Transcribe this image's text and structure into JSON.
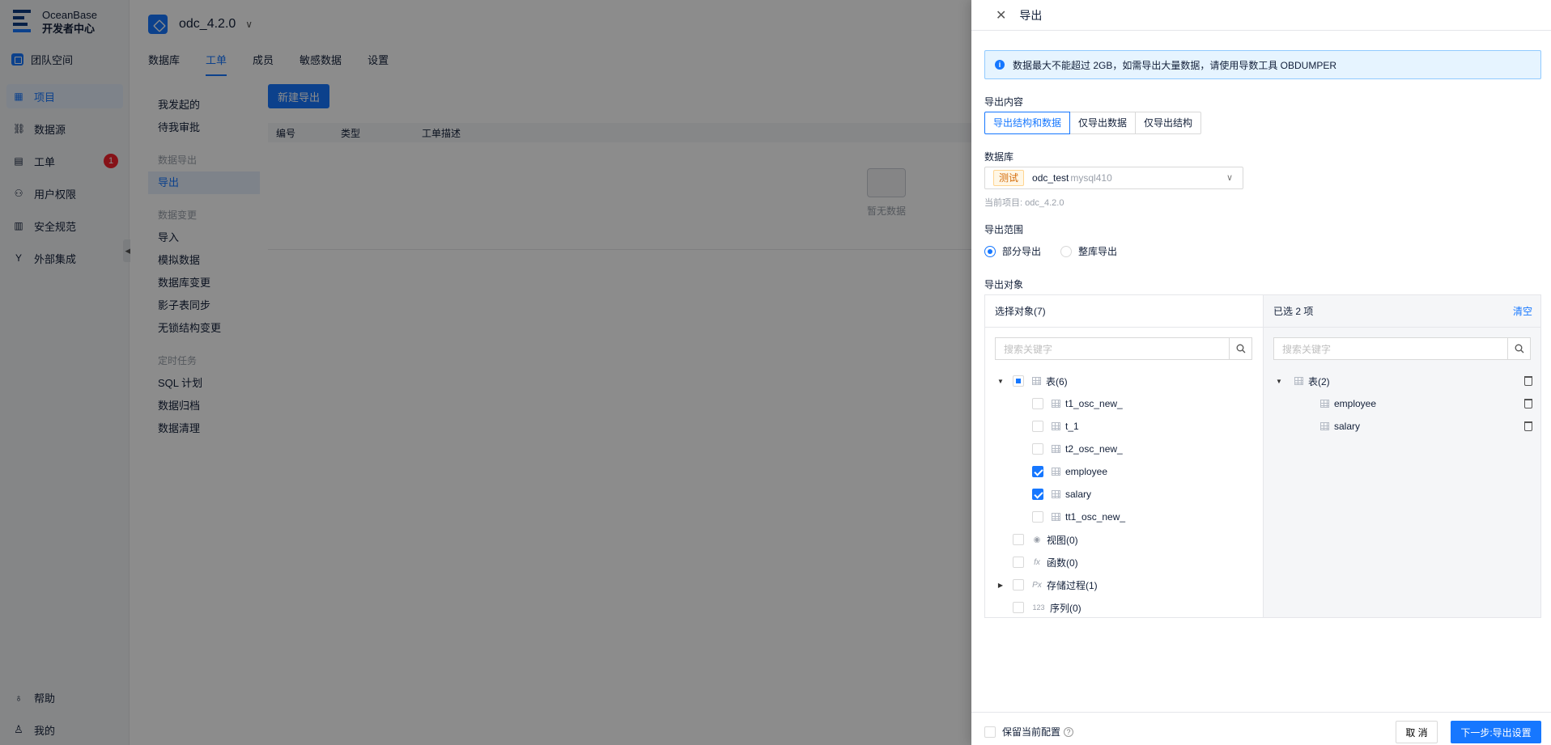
{
  "app": {
    "logo_line1": "OceanBase",
    "logo_line2": "开发者中心",
    "team_space": "团队空间",
    "nav": [
      {
        "label": "项目",
        "icon": "grid-icon",
        "active": true
      },
      {
        "label": "数据源",
        "icon": "link-icon"
      },
      {
        "label": "工单",
        "icon": "briefcase-icon",
        "badge": "1"
      },
      {
        "label": "用户权限",
        "icon": "user-permission-icon"
      },
      {
        "label": "安全规范",
        "icon": "shield-rules-icon"
      },
      {
        "label": "外部集成",
        "icon": "branch-icon"
      }
    ],
    "help": "帮助",
    "me": "我的"
  },
  "project": {
    "name": "odc_4.2.0",
    "tabs": [
      "数据库",
      "工单",
      "成员",
      "敏感数据",
      "设置"
    ],
    "active_tab": "工单"
  },
  "submenu": {
    "mine": "我发起的",
    "pending": "待我审批",
    "group_export": "数据导出",
    "export": "导出",
    "group_change": "数据变更",
    "import": "导入",
    "mock": "模拟数据",
    "db_change": "数据库变更",
    "shadow": "影子表同步",
    "lockless": "无锁结构变更",
    "group_timer": "定时任务",
    "sql_plan": "SQL 计划",
    "archive": "数据归档",
    "cleanup": "数据清理"
  },
  "list": {
    "new_button": "新建导出",
    "col_id": "编号",
    "col_type": "类型",
    "col_desc": "工单描述",
    "empty": "暂无数据"
  },
  "drawer": {
    "title": "导出",
    "alert": "数据最大不能超过 2GB，如需导出大量数据，请使用导数工具 OBDUMPER",
    "content_label": "导出内容",
    "content_options": [
      "导出结构和数据",
      "仅导出数据",
      "仅导出结构"
    ],
    "db_label": "数据库",
    "db_tag": "测试",
    "db_name": "odc_test",
    "db_source": "mysql410",
    "current_project": "当前项目: odc_4.2.0",
    "scope_label": "导出范围",
    "scope_partial": "部分导出",
    "scope_full": "整库导出",
    "object_label": "导出对象",
    "left_title": "选择对象(7)",
    "right_title": "已选 2 项",
    "clear": "清空",
    "search_placeholder": "搜索关键字",
    "tree": {
      "tables": "表(6)",
      "table_items": [
        {
          "name": "t1_osc_new_",
          "checked": false
        },
        {
          "name": "t_1",
          "checked": false
        },
        {
          "name": "t2_osc_new_",
          "checked": false
        },
        {
          "name": "employee",
          "checked": true
        },
        {
          "name": "salary",
          "checked": true
        },
        {
          "name": "tt1_osc_new_",
          "checked": false
        }
      ],
      "views": "视图(0)",
      "functions": "函数(0)",
      "procedures": "存储过程(1)",
      "sequences": "序列(0)"
    },
    "selected": {
      "tables": "表(2)",
      "items": [
        "employee",
        "salary"
      ]
    },
    "keep_config": "保留当前配置",
    "cancel": "取 消",
    "next": "下一步:导出设置"
  }
}
